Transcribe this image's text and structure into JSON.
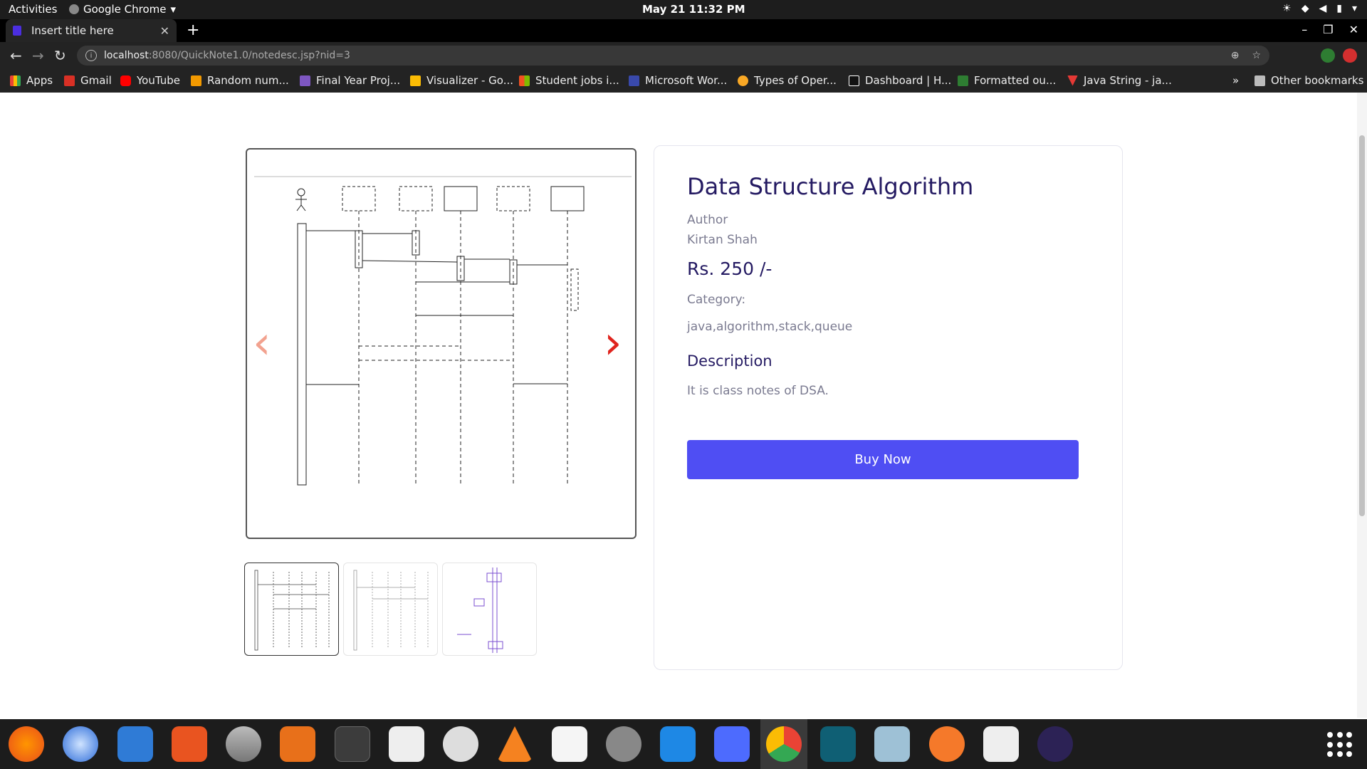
{
  "system": {
    "activities": "Activities",
    "app_name": "Google Chrome",
    "clock": "May 21  11:32 PM"
  },
  "browser": {
    "tab_title": "Insert title here",
    "url_host": "localhost",
    "url_path": ":8080/QuickNote1.0/notedesc.jsp?nid=3",
    "bookmarks": [
      {
        "label": "Apps",
        "color": "#ea4335"
      },
      {
        "label": "Gmail",
        "color": "#d93025"
      },
      {
        "label": "YouTube",
        "color": "#ff0000"
      },
      {
        "label": "Random num...",
        "color": "#f29900"
      },
      {
        "label": "Final Year Proj...",
        "color": "#7e57c2"
      },
      {
        "label": "Visualizer - Go...",
        "color": "#fbbc04"
      },
      {
        "label": "Student jobs i...",
        "color": "#34a853"
      },
      {
        "label": "Microsoft Wor...",
        "color": "#3949ab"
      },
      {
        "label": "Types of Oper...",
        "color": "#f9a825"
      },
      {
        "label": "Dashboard | H...",
        "color": "#ffffff"
      },
      {
        "label": "Formatted ou...",
        "color": "#2e7d32"
      },
      {
        "label": "Java String - ja...",
        "color": "#e53935"
      }
    ],
    "bookmarks_overflow": "»",
    "other_bookmarks": "Other bookmarks"
  },
  "note": {
    "title": "Data Structure Algorithm",
    "author_label": "Author",
    "author": "Kirtan Shah",
    "price": "Rs. 250 /-",
    "category_label": "Category:",
    "category": "java,algorithm,stack,queue",
    "description_heading": "Description",
    "description": "It is class notes of DSA.",
    "buy_label": "Buy Now"
  },
  "carousel": {
    "prev_symbol": "‹",
    "next_symbol": "›",
    "thumbnail_count": 3,
    "active_thumbnail": 1
  },
  "dock": {
    "apps": [
      "firefox-icon",
      "thunderbird-icon",
      "libreoffice-writer-icon",
      "software-center-icon",
      "database-icon",
      "libreoffice-impress-icon",
      "terminal-icon",
      "files-icon",
      "image-viewer-icon",
      "vlc-icon",
      "text-editor-icon",
      "settings-icon",
      "vscode-icon",
      "screenshot-icon",
      "chrome-icon",
      "intellij-icon",
      "camera-icon",
      "blender-icon",
      "rhythmbox-icon",
      "eclipse-icon"
    ]
  }
}
